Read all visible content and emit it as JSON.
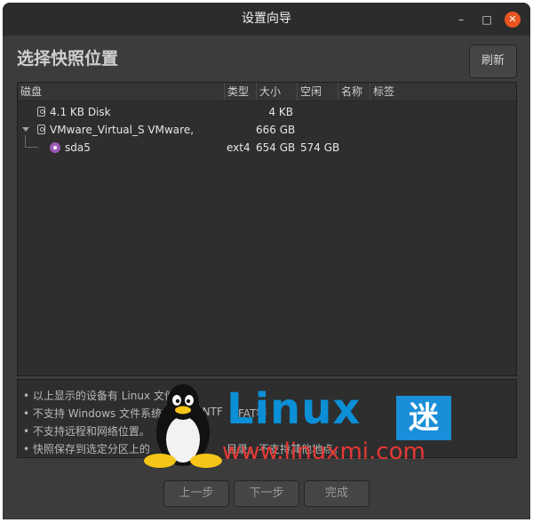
{
  "window": {
    "title": "设置向导"
  },
  "page": {
    "heading": "选择快照位置",
    "refresh_label": "刷新"
  },
  "table": {
    "headers": [
      "磁盘",
      "类型",
      "大小",
      "空闲",
      "名称",
      "标签"
    ],
    "rows": [
      {
        "name": "4.1 KB Disk",
        "type": "",
        "size": "4 KB",
        "free": "",
        "label_name": "",
        "tag": ""
      },
      {
        "name": "VMware_Virtual_S VMware,",
        "type": "",
        "size": "666 GB",
        "free": "",
        "label_name": "",
        "tag": ""
      },
      {
        "name": "sda5",
        "type": "ext4",
        "size": "654 GB",
        "free": "574 GB",
        "label_name": "",
        "tag": ""
      }
    ]
  },
  "notes": [
    "• 以上显示的设备有 Linux 文件",
    "• 不支持 Windows 文件系统的",
    "• 不支持远程和网络位置。",
    "• 快照保存到选定分区上的",
    "(NTF",
    "FAT等",
    "目录。不支持其他地点。"
  ],
  "nav": {
    "prev": "上一步",
    "next": "下一步",
    "finish": "完成"
  },
  "watermark": {
    "brand": "Linux",
    "mi": "迷",
    "url": "www.linuxmi.com"
  },
  "colors": {
    "accent_close": "#e95420",
    "partition_icon": "#9b59b6",
    "watermark_blue": "#0b8fd6",
    "watermark_red": "#e53935"
  }
}
